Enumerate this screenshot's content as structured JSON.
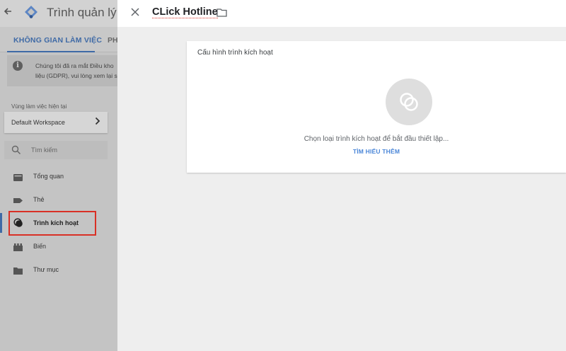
{
  "left_panel": {
    "app_title": "Trình quản lý th",
    "tabs": [
      {
        "label": "KHÔNG GIAN LÀM VIỆC"
      },
      {
        "label": "PH"
      }
    ],
    "notice": {
      "line1": "Chúng tôi đã ra mắt Điều kho",
      "line2": "liệu (GDPR), vui lòng xem lại s"
    },
    "workspace": {
      "label": "Vùng làm việc hiện tại",
      "name": "Default Workspace"
    },
    "search": {
      "placeholder": "Tìm kiếm"
    },
    "nav": [
      {
        "label": "Tổng quan",
        "icon": "overview-folder-icon"
      },
      {
        "label": "Thẻ",
        "icon": "tag-icon"
      },
      {
        "label": "Trình kích hoạt",
        "icon": "trigger-icon",
        "active": true
      },
      {
        "label": "Biến",
        "icon": "variable-icon"
      },
      {
        "label": "Thư mục",
        "icon": "folder-icon"
      }
    ]
  },
  "editor": {
    "name": "CLick Hotline",
    "card": {
      "title": "Cấu hình trình kích hoạt",
      "message": "Chọn loại trình kích hoạt để bắt đầu thiết lập...",
      "link": "TÌM HIỂU THÊM"
    }
  },
  "colors": {
    "accent": "#3f6aa6",
    "link": "#4a86d8",
    "highlight": "#d93025"
  }
}
